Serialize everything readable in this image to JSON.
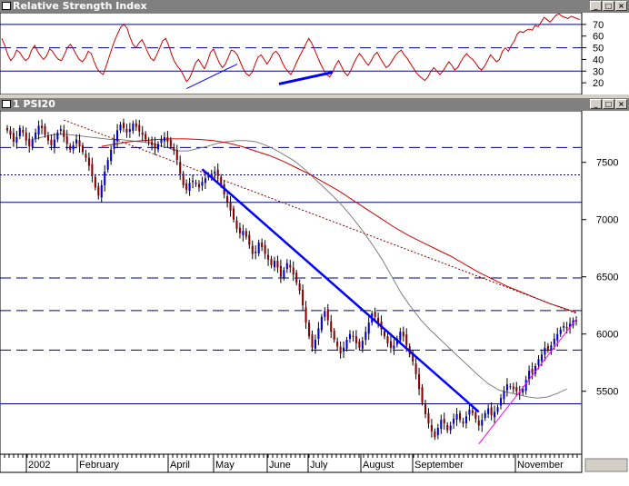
{
  "rsi_window": {
    "title": "Relative Strength Index"
  },
  "price_window": {
    "title": "1 PSI20"
  },
  "window_buttons": [
    "_",
    "□",
    "×"
  ],
  "chart_data": [
    {
      "type": "line",
      "title": "Relative Strength Index",
      "ylim": [
        10,
        80
      ],
      "yticks": [
        70,
        60,
        50,
        40,
        30,
        20
      ],
      "reference_lines": [
        {
          "y": 70,
          "style": "solid"
        },
        {
          "y": 50,
          "style": "dashed"
        },
        {
          "y": 30,
          "style": "solid"
        }
      ],
      "series": [
        {
          "values": [
            58,
            52,
            44,
            39,
            42,
            48,
            46,
            42,
            39,
            41,
            48,
            52,
            47,
            43,
            40,
            43,
            49,
            47,
            43,
            40,
            39,
            44,
            50,
            53,
            49,
            44,
            40,
            38,
            41,
            47,
            45,
            38,
            32,
            29,
            27,
            34,
            42,
            50,
            57,
            63,
            68,
            70,
            67,
            59,
            53,
            50,
            54,
            57,
            52,
            46,
            41,
            39,
            44,
            50,
            56,
            58,
            52,
            44,
            38,
            34,
            31,
            26,
            21,
            24,
            30,
            37,
            40,
            36,
            32,
            38,
            46,
            49,
            43,
            37,
            33,
            36,
            42,
            48,
            47,
            44,
            38,
            32,
            28,
            26,
            29,
            36,
            42,
            44,
            40,
            36,
            40,
            45,
            47,
            44,
            38,
            33,
            30,
            27,
            32,
            38,
            43,
            48,
            53,
            58,
            54,
            48,
            42,
            36,
            31,
            27,
            25,
            29,
            35,
            39,
            34,
            29,
            26,
            30,
            36,
            41,
            45,
            42,
            38,
            35,
            39,
            44,
            46,
            41,
            37,
            33,
            35,
            39,
            43,
            46,
            48,
            44,
            41,
            37,
            33,
            29,
            26,
            24,
            22,
            25,
            30,
            33,
            30,
            27,
            30,
            34,
            38,
            35,
            31,
            33,
            38,
            42,
            45,
            42,
            40,
            37,
            33,
            31,
            34,
            39,
            44,
            41,
            38,
            40,
            47,
            50,
            47,
            52,
            56,
            62,
            64,
            63,
            65,
            66,
            65,
            69,
            68,
            72,
            76,
            74,
            72,
            75,
            78,
            79,
            77,
            76,
            75,
            77,
            76,
            75,
            74
          ]
        }
      ]
    },
    {
      "type": "candlestick",
      "title": "1 PSI20",
      "ylim": [
        4950,
        7950
      ],
      "yticks": [
        7500,
        7000,
        6500,
        6000,
        5500
      ],
      "x_labels": [
        "2002",
        "February",
        "April",
        "May",
        "June",
        "July",
        "August",
        "September",
        "November"
      ],
      "horizontal_lines": [
        {
          "y": 7630,
          "style": "dashed"
        },
        {
          "y": 7390,
          "style": "dotted"
        },
        {
          "y": 7150,
          "style": "solid"
        },
        {
          "y": 6490,
          "style": "dashed"
        },
        {
          "y": 6205,
          "style": "dashed"
        },
        {
          "y": 5860,
          "style": "dashed"
        },
        {
          "y": 5390,
          "style": "solid"
        }
      ],
      "series": [
        {
          "name": "close",
          "values": [
            7780,
            7740,
            7680,
            7720,
            7800,
            7760,
            7690,
            7640,
            7700,
            7760,
            7820,
            7800,
            7740,
            7690,
            7650,
            7700,
            7760,
            7790,
            7720,
            7660,
            7610,
            7650,
            7700,
            7640,
            7590,
            7540,
            7470,
            7380,
            7280,
            7210,
            7300,
            7420,
            7520,
            7610,
            7700,
            7780,
            7830,
            7800,
            7760,
            7790,
            7840,
            7810,
            7770,
            7740,
            7700,
            7680,
            7650,
            7620,
            7660,
            7700,
            7720,
            7680,
            7640,
            7600,
            7520,
            7400,
            7300,
            7260,
            7320,
            7340,
            7310,
            7280,
            7330,
            7360,
            7390,
            7400,
            7420,
            7380,
            7300,
            7220,
            7150,
            7080,
            7000,
            6920,
            6880,
            6900,
            6850,
            6780,
            6700,
            6720,
            6800,
            6760,
            6700,
            6650,
            6600,
            6640,
            6580,
            6500,
            6560,
            6620,
            6580,
            6520,
            6450,
            6380,
            6250,
            6100,
            5980,
            5880,
            5950,
            6050,
            6150,
            6200,
            6120,
            6020,
            5950,
            5890,
            5830,
            5880,
            5950,
            6000,
            5980,
            5920,
            5880,
            5940,
            6020,
            6100,
            6180,
            6150,
            6100,
            6040,
            5980,
            5920,
            5880,
            5900,
            5960,
            6020,
            5980,
            5900,
            5820,
            5760,
            5650,
            5520,
            5400,
            5300,
            5220,
            5150,
            5100,
            5180,
            5250,
            5220,
            5160,
            5200,
            5260,
            5300,
            5250,
            5220,
            5280,
            5340,
            5310,
            5260,
            5200,
            5250,
            5310,
            5350,
            5290,
            5320,
            5360,
            5440,
            5500,
            5560,
            5540,
            5520,
            5500,
            5480,
            5520,
            5600,
            5680,
            5660,
            5720,
            5780,
            5820,
            5880,
            5860,
            5900,
            5960,
            6000,
            6040,
            6070,
            6050,
            6090,
            6120,
            6110
          ]
        },
        {
          "name": "sma_short",
          "values": [
            7700,
            7720,
            7740,
            7745,
            7740,
            7730,
            7720,
            7710,
            7700,
            7700,
            7690,
            7680,
            7670,
            7650,
            7625,
            7600,
            7600,
            7620,
            7640,
            7665,
            7680,
            7690,
            7690,
            7680,
            7650,
            7610,
            7560,
            7510,
            7440,
            7360,
            7280,
            7200,
            7110,
            7010,
            6900,
            6780,
            6650,
            6500,
            6350,
            6230,
            6120,
            6030,
            5950,
            5870,
            5790,
            5710,
            5630,
            5560,
            5510,
            5490,
            5470,
            5450,
            5440,
            5450,
            5480,
            5520
          ]
        },
        {
          "name": "sma_long",
          "values": [
            7640,
            7660,
            7680,
            7690,
            7700,
            7705,
            7705,
            7700,
            7690,
            7670,
            7640,
            7600,
            7560,
            7510,
            7450,
            7390,
            7320,
            7250,
            7170,
            7090,
            7010,
            6930,
            6860,
            6800,
            6740,
            6680,
            6610,
            6540,
            6480,
            6420,
            6370,
            6320,
            6270,
            6230,
            6190
          ]
        }
      ],
      "trendlines": [
        {
          "label": "downtrend",
          "style": "solid",
          "color": "#0000ff",
          "from": {
            "x": "June",
            "y": 7440
          },
          "to": {
            "x": "October",
            "y": 5320
          }
        },
        {
          "label": "uptrend",
          "style": "solid",
          "color": "#ff00ff",
          "from": {
            "x": "October",
            "y": 5040
          },
          "to": {
            "x": "November",
            "y": 6130
          }
        },
        {
          "label": "resistance",
          "style": "dotted",
          "color": "#800000",
          "from": {
            "x": "February",
            "y": 7870
          },
          "to": {
            "x": "November",
            "y": 6180
          }
        }
      ]
    }
  ]
}
